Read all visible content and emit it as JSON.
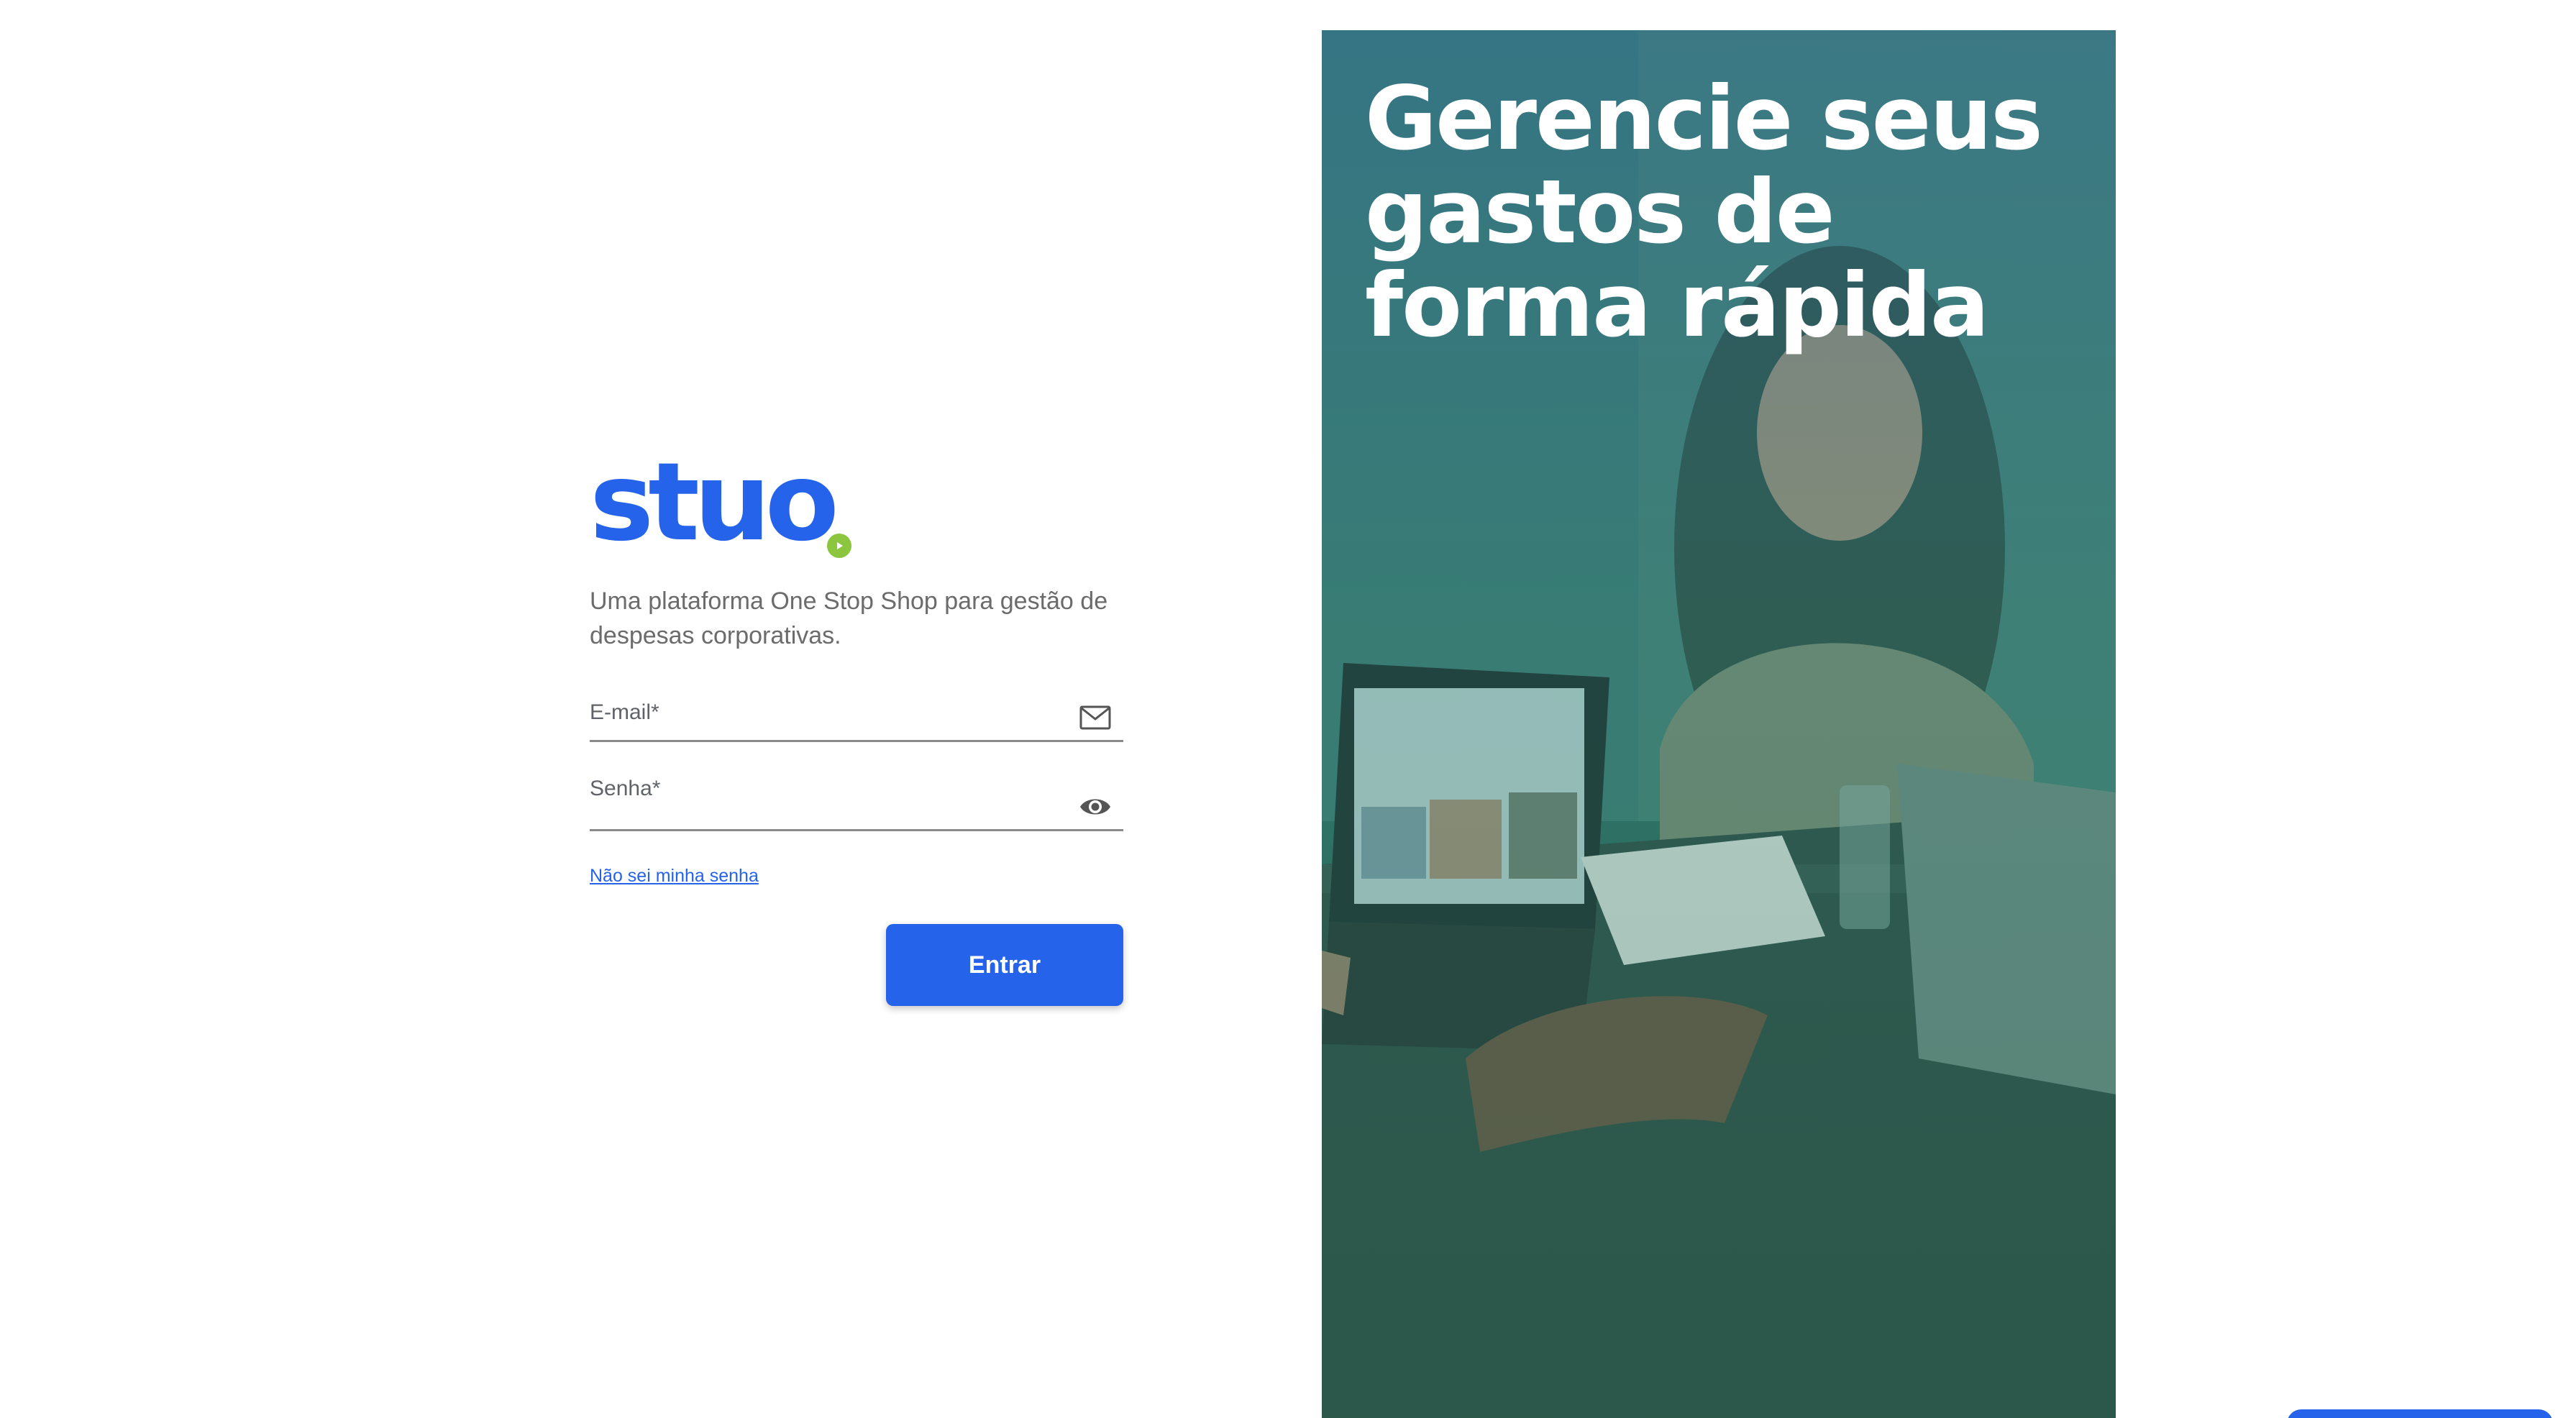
{
  "brand": {
    "logo_text": "stuo",
    "logo_color": "#2563eb",
    "logo_dot_color": "#8cc63f",
    "tagline": "Uma plataforma One Stop Shop para gestão de despesas corporativas."
  },
  "form": {
    "email": {
      "label": "E-mail*",
      "value": "",
      "icon": "mail-icon"
    },
    "password": {
      "label": "Senha*",
      "value": "",
      "icon": "eye-icon"
    },
    "forgot_link": "Não sei minha senha",
    "submit_label": "Entrar"
  },
  "hero": {
    "title": "Gerencie seus gastos de forma rápida"
  },
  "colors": {
    "accent": "#2563eb",
    "hero_tint": "#2f6d68"
  }
}
